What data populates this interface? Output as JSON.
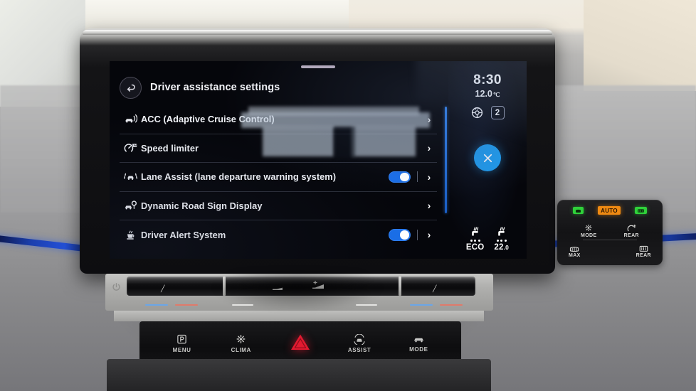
{
  "screen": {
    "header": {
      "title": "Driver assistance settings",
      "back_icon": "back-arrow-icon"
    },
    "list": [
      {
        "label": "ACC (Adaptive Cruise Control)",
        "icon": "adaptive-cruise-control-icon",
        "toggle": null,
        "chevron": "›"
      },
      {
        "label": "Speed limiter",
        "icon": "speed-limiter-icon",
        "toggle": null,
        "chevron": "›"
      },
      {
        "label": "Lane Assist (lane departure warning system)",
        "icon": "lane-assist-icon",
        "toggle": "on",
        "chevron": "›"
      },
      {
        "label": "Dynamic Road Sign Display",
        "icon": "road-sign-display-icon",
        "toggle": null,
        "chevron": "›"
      },
      {
        "label": "Driver Alert System",
        "icon": "coffee-cup-icon",
        "toggle": "on",
        "chevron": "›"
      }
    ],
    "status_rail": {
      "clock": "8:30",
      "temperature": "12.0",
      "temperature_unit": "℃",
      "steering_wheel_icon": "heated-steering-wheel-icon",
      "fan_level": "2",
      "close_button_icon": "close-x-icon",
      "seat_left": {
        "icon": "heated-seat-icon",
        "level_dots": 3,
        "label": "ECO"
      },
      "seat_right": {
        "icon": "heated-seat-icon",
        "level_dots": 3,
        "label_int": "22",
        "label_dec": ".0"
      }
    },
    "colors": {
      "toggle_on": "#1a6ee8",
      "scrollbar": "#2f7ee8",
      "close_button": "#1c9ef0",
      "screen_bg": "#05060b",
      "text": "#f0f2f7"
    }
  },
  "slider_strip": {
    "power_icon": "power-icon",
    "left_mark": "temperature-slider-left",
    "right_mark": "temperature-slider-right",
    "volume_down_icon": "volume-down-icon",
    "volume_up_icon": "volume-up-icon"
  },
  "hard_keys": [
    {
      "label": "MENU",
      "icon": "parking-p-icon"
    },
    {
      "label": "CLIMA",
      "icon": "fan-icon"
    },
    {
      "label": "",
      "icon": "hazard-triangle-icon"
    },
    {
      "label": "ASSIST",
      "icon": "park-assist-icon"
    },
    {
      "label": "MODE",
      "icon": "drive-mode-icon"
    }
  ],
  "hvac_panel": {
    "indicators": [
      {
        "name": "front-defrost-indicator",
        "text": "",
        "color": "#2fd13a"
      },
      {
        "name": "auto-indicator",
        "text": "AUTO",
        "color": "#f08a12"
      },
      {
        "name": "rear-defrost-indicator",
        "text": "",
        "color": "#2fd13a"
      }
    ],
    "buttons": [
      {
        "label": "MODE",
        "icon": "air-mode-icon"
      },
      {
        "label": "REAR",
        "icon": "rear-wiper-icon"
      },
      {
        "label": "MAX",
        "icon": "max-defrost-icon"
      },
      {
        "label": "REAR",
        "icon": "rear-defrost-icon"
      }
    ]
  }
}
